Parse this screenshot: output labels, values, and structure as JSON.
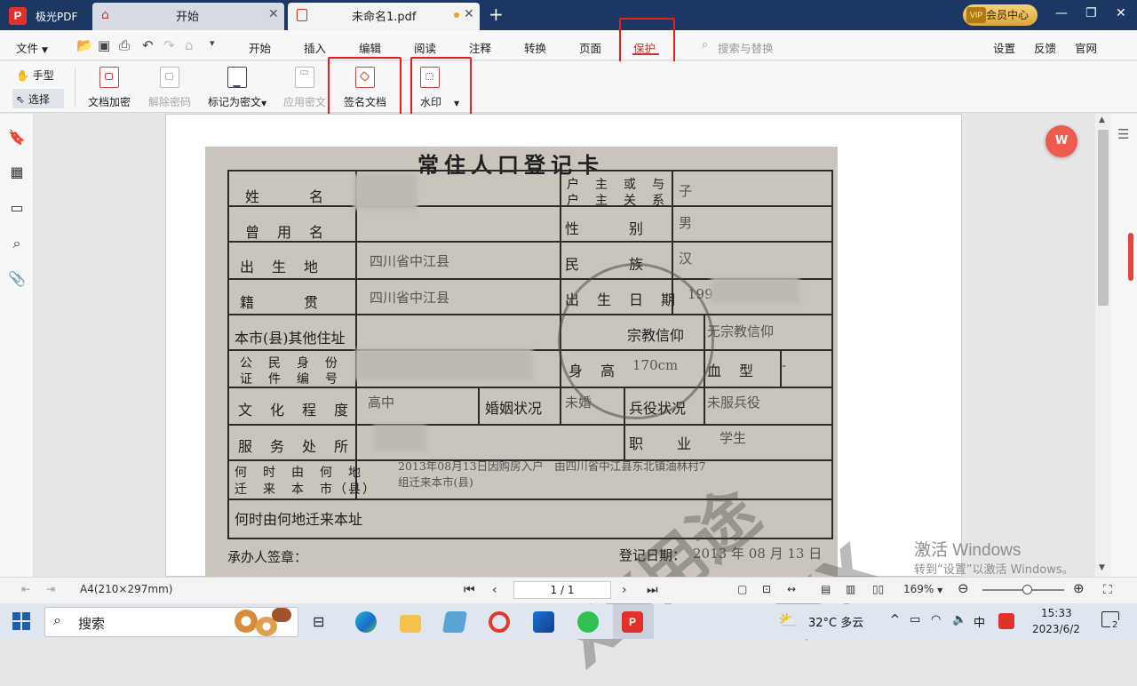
{
  "titlebar": {
    "app_name": "极光PDF",
    "tabs": [
      {
        "label": "开始"
      },
      {
        "label": "未命名1.pdf"
      }
    ],
    "vip_label": "会员中心",
    "vip_badge": "VIP"
  },
  "menubar": {
    "file": "文件",
    "items": [
      "开始",
      "插入",
      "编辑",
      "阅读",
      "注释",
      "转换",
      "页面",
      "保护"
    ],
    "active": "保护",
    "search_placeholder": "搜索与替换",
    "right": [
      "设置",
      "反馈",
      "官网"
    ]
  },
  "ribbon": {
    "hand": "手型",
    "select": "选择",
    "tools": [
      {
        "label": "文档加密",
        "enabled": true
      },
      {
        "label": "解除密码",
        "enabled": false
      },
      {
        "label": "标记为密文",
        "enabled": true
      },
      {
        "label": "应用密文",
        "enabled": false
      },
      {
        "label": "签名文档",
        "enabled": true
      },
      {
        "label": "水印",
        "enabled": true
      }
    ]
  },
  "document": {
    "card_title": "常住人口登记卡",
    "labels": {
      "name": "姓　　　名",
      "former_name": "曾　用　名",
      "birthplace": "出　生　地",
      "native": "籍　　　贯",
      "other_address": "本市(县)其他住址",
      "id_no_1": "公　民　身　份",
      "id_no_2": "证　件　编　号",
      "education": "文　化　程　度",
      "workplace": "服　务　处　所",
      "moved_in_1": "何　时　由　何　地",
      "moved_in_2": "迁　来　本　市（县）",
      "moved_out": "何时由何地迁来本址",
      "relation_1": "户　主　或　与",
      "relation_2": "户　主　关　系",
      "gender": "性　　　别",
      "ethnicity": "民　　　族",
      "birthdate": "出　生　日　期",
      "religion": "宗教信仰",
      "height": "身　高",
      "blood": "血　型",
      "marital": "婚姻状况",
      "military": "兵役状况",
      "occupation": "职　　业",
      "handler": "承办人签章：",
      "reg_date": "登记日期："
    },
    "values": {
      "relation": "子",
      "gender": "男",
      "ethnicity": "汉",
      "birthplace": "四川省中江县",
      "native": "四川省中江县",
      "religion": "无宗教信仰",
      "height": "170cm",
      "education": "高中",
      "marital": "未婚",
      "military": "未服兵役",
      "occupation": "学生",
      "moved_in_1": "2013年08月13日因购房入户　由四川省中江县东北镇油林村7",
      "moved_in_2": "组迁来本市(县)",
      "reg_date": "2013 年 08 月 13 日",
      "birth_year_partial": "199",
      "blood_value": "-"
    },
    "watermark": "XX用途",
    "watermark2": "XX"
  },
  "activate": {
    "line1": "激活 Windows",
    "line2": "转到“设置”以激活 Windows。"
  },
  "statusbar": {
    "page_size": "A4(210×297mm)",
    "page_indicator": "1 / 1",
    "zoom": "169%"
  },
  "taskbar": {
    "search": "搜索",
    "weather": "32°C  多云",
    "ime": "中",
    "time": "15:33",
    "date": "2023/6/2",
    "notifications": "2"
  }
}
